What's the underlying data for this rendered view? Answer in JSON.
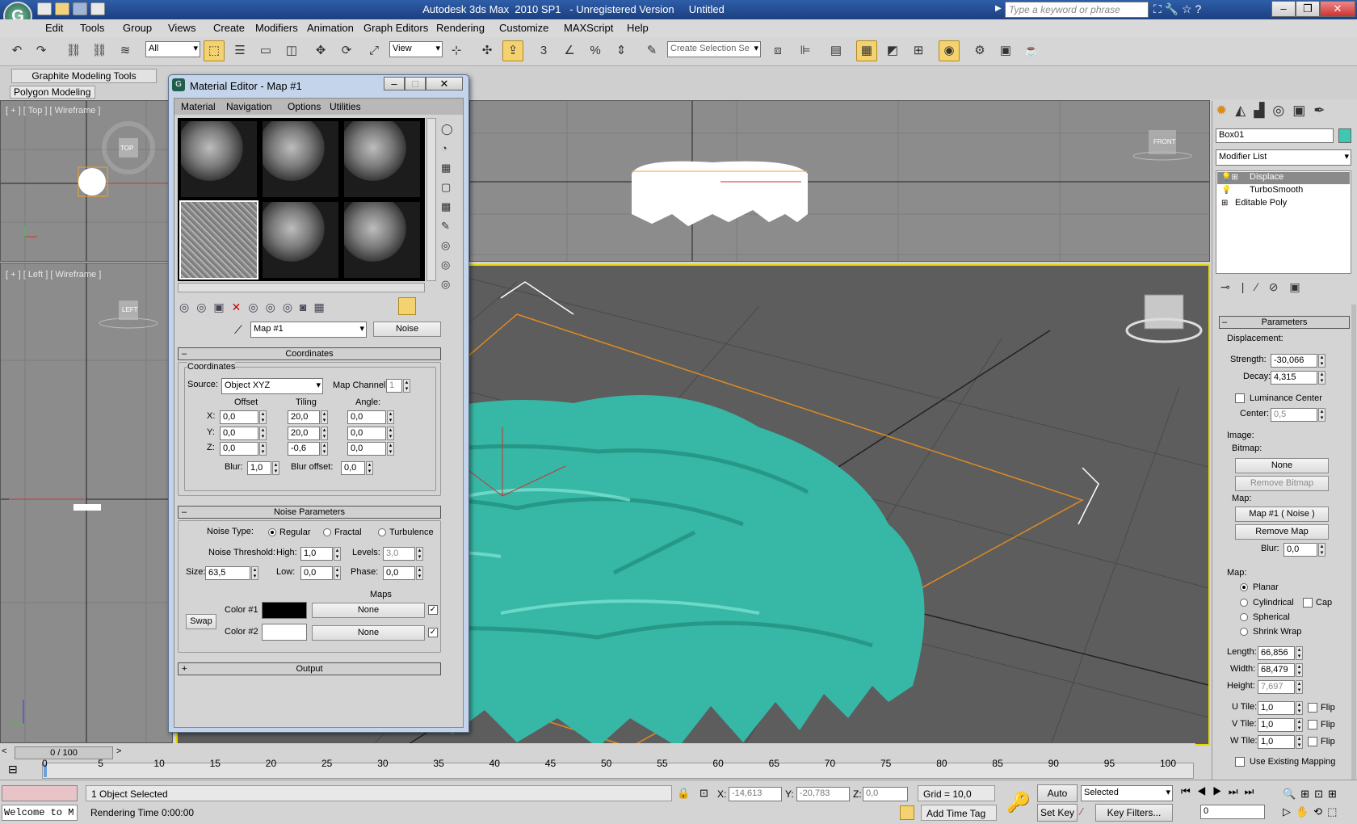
{
  "window": {
    "title": "Autodesk 3ds Max  2010 SP1   - Unregistered Version     Untitled",
    "search_placeholder": "Type a keyword or phrase",
    "logo_text": "G"
  },
  "menu": [
    "Edit",
    "Tools",
    "Group",
    "Views",
    "Create",
    "Modifiers",
    "Animation",
    "Graph Editors",
    "Rendering",
    "Customize",
    "MAXScript",
    "Help"
  ],
  "toolbar": {
    "filter_value": "All",
    "refcoord_value": "View",
    "selection_set_placeholder": "Create Selection Se"
  },
  "ribbon": {
    "tab": "Graphite Modeling Tools",
    "subtab": "Polygon Modeling"
  },
  "viewports": {
    "top_label": "[ + ] [ Top ] [ Wireframe ]",
    "left_label": "[ + ] [ Left ] [ Wireframe ]",
    "top_cube": "TOP",
    "left_cube": "LEFT",
    "front_cube": "FRONT"
  },
  "material_editor": {
    "title": "Material Editor - Map #1",
    "menus": [
      "Material",
      "Navigation",
      "Options",
      "Utilities"
    ],
    "map_name": "Map #1",
    "map_type": "Noise",
    "coordinates": {
      "rollout_title": "Coordinates",
      "group_title": "Coordinates",
      "source_label": "Source:",
      "source_value": "Object XYZ",
      "map_channel_label": "Map Channel:",
      "map_channel_value": "1",
      "offset_label": "Offset",
      "tiling_label": "Tiling",
      "angle_label": "Angle:",
      "axis": [
        "X:",
        "Y:",
        "Z:"
      ],
      "offset": [
        "0,0",
        "0,0",
        "0,0"
      ],
      "tiling": [
        "20,0",
        "20,0",
        "-0,6"
      ],
      "angle": [
        "0,0",
        "0,0",
        "0,0"
      ],
      "blur_label": "Blur:",
      "blur_value": "1,0",
      "blur_offset_label": "Blur offset:",
      "blur_offset_value": "0,0"
    },
    "noise": {
      "rollout_title": "Noise Parameters",
      "type_label": "Noise Type:",
      "types": [
        "Regular",
        "Fractal",
        "Turbulence"
      ],
      "selected_type": "Regular",
      "threshold_label": "Noise Threshold:",
      "high_label": "High:",
      "high_value": "1,0",
      "levels_label": "Levels:",
      "levels_value": "3,0",
      "size_label": "Size:",
      "size_value": "63,5",
      "low_label": "Low:",
      "low_value": "0,0",
      "phase_label": "Phase:",
      "phase_value": "0,0",
      "maps_label": "Maps",
      "swap_label": "Swap",
      "color1_label": "Color #1",
      "color1": "#000000",
      "color2_label": "Color #2",
      "color2": "#ffffff",
      "map1": "None",
      "map2": "None"
    },
    "output_rollout": "Output"
  },
  "command_panel": {
    "object_name": "Box01",
    "object_color": "#3ec8b4",
    "modifier_list": "Modifier List",
    "stack": [
      "Displace",
      "TurboSmooth",
      "Editable Poly"
    ],
    "params_title": "Parameters",
    "displacement_label": "Displacement:",
    "strength_label": "Strength:",
    "strength_value": "-30,066",
    "decay_label": "Decay:",
    "decay_value": "4,315",
    "luminance_label": "Luminance Center",
    "center_label": "Center:",
    "center_value": "0,5",
    "image_label": "Image:",
    "bitmap_label": "Bitmap:",
    "bitmap_button": "None",
    "remove_bitmap": "Remove Bitmap",
    "map_label": "Map:",
    "map_button": "Map #1  ( Noise )",
    "remove_map": "Remove Map",
    "blur_label": "Blur:",
    "blur_value": "0,0",
    "mapping_label": "Map:",
    "mapping_types": [
      "Planar",
      "Cylindrical",
      "Spherical",
      "Shrink Wrap"
    ],
    "cap_label": "Cap",
    "length_label": "Length:",
    "length_value": "66,856",
    "width_label": "Width:",
    "width_value": "68,479",
    "height_label": "Height:",
    "height_value": "7,697",
    "utile_label": "U Tile:",
    "utile_value": "1,0",
    "vtile_label": "V Tile:",
    "vtile_value": "1,0",
    "wtile_label": "W Tile:",
    "wtile_value": "1,0",
    "flip_label": "Flip",
    "use_existing_label": "Use Existing Mapping"
  },
  "timeline": {
    "frame_counter": "0 / 100",
    "ticks": [
      "0",
      "5",
      "10",
      "15",
      "20",
      "25",
      "30",
      "35",
      "40",
      "45",
      "50",
      "55",
      "60",
      "65",
      "70",
      "75",
      "80",
      "85",
      "90",
      "95",
      "100"
    ]
  },
  "status": {
    "listener": "Welcome to M",
    "selection_info": "1 Object Selected",
    "render_time": "Rendering Time  0:00:00",
    "x_label": "X:",
    "x_value": "-14,613",
    "y_label": "Y:",
    "y_value": "-20,783",
    "z_label": "Z:",
    "z_value": "0,0",
    "grid": "Grid = 10,0",
    "add_time_tag": "Add Time Tag",
    "auto_key": "Auto Key",
    "set_key": "Set Key",
    "selected_dropdown": "Selected",
    "key_filters": "Key Filters...",
    "current_frame": "0"
  }
}
